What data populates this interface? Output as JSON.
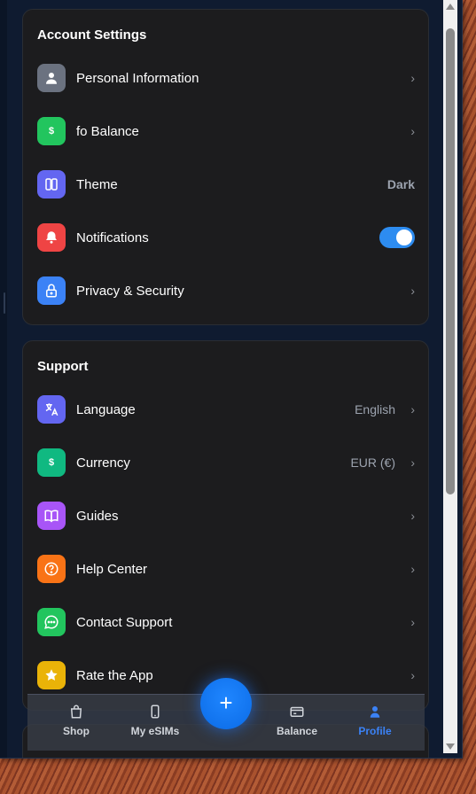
{
  "account_settings": {
    "title": "Account Settings",
    "items": [
      {
        "label": "Personal Information",
        "icon": "user-icon",
        "color": "#6b7280"
      },
      {
        "label": "fo Balance",
        "icon": "dollar-icon",
        "color": "#22c55e"
      },
      {
        "label": "Theme",
        "icon": "columns-icon",
        "color": "#6366f1",
        "value": "Dark"
      },
      {
        "label": "Notifications",
        "icon": "bell-icon",
        "color": "#ef4444",
        "toggle_on": true
      },
      {
        "label": "Privacy & Security",
        "icon": "lock-icon",
        "color": "#3b82f6"
      }
    ]
  },
  "support": {
    "title": "Support",
    "items": [
      {
        "label": "Language",
        "icon": "translate-icon",
        "color": "#6366f1",
        "value": "English"
      },
      {
        "label": "Currency",
        "icon": "dollar-icon",
        "color": "#10b981",
        "value": "EUR (€)"
      },
      {
        "label": "Guides",
        "icon": "book-icon",
        "color": "#a855f7"
      },
      {
        "label": "Help Center",
        "icon": "help-icon",
        "color": "#f97316"
      },
      {
        "label": "Contact Support",
        "icon": "chat-icon",
        "color": "#22c55e"
      },
      {
        "label": "Rate the App",
        "icon": "star-icon",
        "color": "#eab308"
      }
    ]
  },
  "chevron": "›",
  "dollar_glyph": "$",
  "tabbar": {
    "tabs": [
      {
        "label": "Shop",
        "icon": "bag-icon",
        "active": false
      },
      {
        "label": "My eSIMs",
        "icon": "phone-icon",
        "active": false
      },
      {
        "label": "Balance",
        "icon": "wallet-icon",
        "active": false
      },
      {
        "label": "Profile",
        "icon": "profile-icon",
        "active": true
      }
    ],
    "fab_label": "+",
    "accent": "#3b82f6"
  }
}
